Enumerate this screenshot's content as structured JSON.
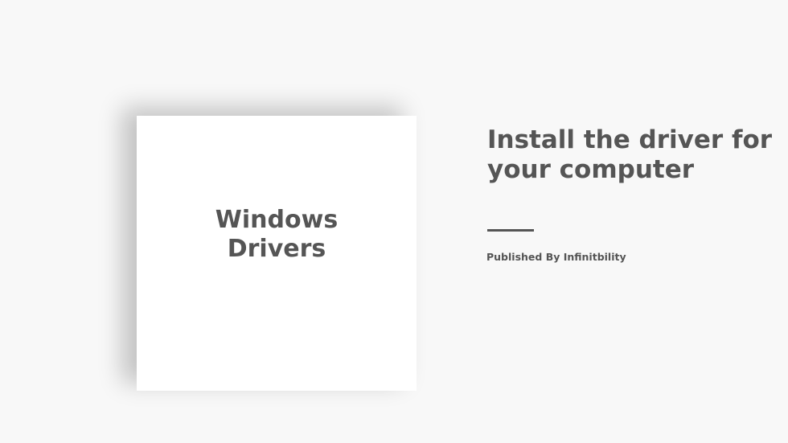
{
  "card": {
    "title": "Windows\nDrivers"
  },
  "hero": {
    "headline": "Install the driver for your computer",
    "publisher": "Published By Infinitbility"
  },
  "colors": {
    "background": "#f8f8f8",
    "card": "#ffffff",
    "text": "#555555"
  }
}
